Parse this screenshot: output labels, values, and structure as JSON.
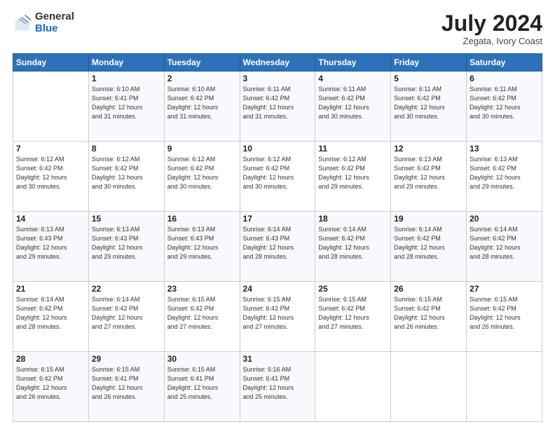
{
  "header": {
    "logo": {
      "general": "General",
      "blue": "Blue"
    },
    "month": "July 2024",
    "location": "Zegata, Ivory Coast"
  },
  "weekdays": [
    "Sunday",
    "Monday",
    "Tuesday",
    "Wednesday",
    "Thursday",
    "Friday",
    "Saturday"
  ],
  "weeks": [
    [
      {
        "day": "",
        "sunrise": "",
        "sunset": "",
        "daylight": ""
      },
      {
        "day": "1",
        "sunrise": "Sunrise: 6:10 AM",
        "sunset": "Sunset: 6:41 PM",
        "daylight": "Daylight: 12 hours and 31 minutes."
      },
      {
        "day": "2",
        "sunrise": "Sunrise: 6:10 AM",
        "sunset": "Sunset: 6:42 PM",
        "daylight": "Daylight: 12 hours and 31 minutes."
      },
      {
        "day": "3",
        "sunrise": "Sunrise: 6:11 AM",
        "sunset": "Sunset: 6:42 PM",
        "daylight": "Daylight: 12 hours and 31 minutes."
      },
      {
        "day": "4",
        "sunrise": "Sunrise: 6:11 AM",
        "sunset": "Sunset: 6:42 PM",
        "daylight": "Daylight: 12 hours and 30 minutes."
      },
      {
        "day": "5",
        "sunrise": "Sunrise: 6:11 AM",
        "sunset": "Sunset: 6:42 PM",
        "daylight": "Daylight: 12 hours and 30 minutes."
      },
      {
        "day": "6",
        "sunrise": "Sunrise: 6:11 AM",
        "sunset": "Sunset: 6:42 PM",
        "daylight": "Daylight: 12 hours and 30 minutes."
      }
    ],
    [
      {
        "day": "7",
        "sunrise": "Sunrise: 6:12 AM",
        "sunset": "Sunset: 6:42 PM",
        "daylight": "Daylight: 12 hours and 30 minutes."
      },
      {
        "day": "8",
        "sunrise": "Sunrise: 6:12 AM",
        "sunset": "Sunset: 6:42 PM",
        "daylight": "Daylight: 12 hours and 30 minutes."
      },
      {
        "day": "9",
        "sunrise": "Sunrise: 6:12 AM",
        "sunset": "Sunset: 6:42 PM",
        "daylight": "Daylight: 12 hours and 30 minutes."
      },
      {
        "day": "10",
        "sunrise": "Sunrise: 6:12 AM",
        "sunset": "Sunset: 6:42 PM",
        "daylight": "Daylight: 12 hours and 30 minutes."
      },
      {
        "day": "11",
        "sunrise": "Sunrise: 6:12 AM",
        "sunset": "Sunset: 6:42 PM",
        "daylight": "Daylight: 12 hours and 29 minutes."
      },
      {
        "day": "12",
        "sunrise": "Sunrise: 6:13 AM",
        "sunset": "Sunset: 6:42 PM",
        "daylight": "Daylight: 12 hours and 29 minutes."
      },
      {
        "day": "13",
        "sunrise": "Sunrise: 6:13 AM",
        "sunset": "Sunset: 6:42 PM",
        "daylight": "Daylight: 12 hours and 29 minutes."
      }
    ],
    [
      {
        "day": "14",
        "sunrise": "Sunrise: 6:13 AM",
        "sunset": "Sunset: 6:43 PM",
        "daylight": "Daylight: 12 hours and 29 minutes."
      },
      {
        "day": "15",
        "sunrise": "Sunrise: 6:13 AM",
        "sunset": "Sunset: 6:43 PM",
        "daylight": "Daylight: 12 hours and 29 minutes."
      },
      {
        "day": "16",
        "sunrise": "Sunrise: 6:13 AM",
        "sunset": "Sunset: 6:43 PM",
        "daylight": "Daylight: 12 hours and 29 minutes."
      },
      {
        "day": "17",
        "sunrise": "Sunrise: 6:14 AM",
        "sunset": "Sunset: 6:43 PM",
        "daylight": "Daylight: 12 hours and 28 minutes."
      },
      {
        "day": "18",
        "sunrise": "Sunrise: 6:14 AM",
        "sunset": "Sunset: 6:42 PM",
        "daylight": "Daylight: 12 hours and 28 minutes."
      },
      {
        "day": "19",
        "sunrise": "Sunrise: 6:14 AM",
        "sunset": "Sunset: 6:42 PM",
        "daylight": "Daylight: 12 hours and 28 minutes."
      },
      {
        "day": "20",
        "sunrise": "Sunrise: 6:14 AM",
        "sunset": "Sunset: 6:42 PM",
        "daylight": "Daylight: 12 hours and 28 minutes."
      }
    ],
    [
      {
        "day": "21",
        "sunrise": "Sunrise: 6:14 AM",
        "sunset": "Sunset: 6:42 PM",
        "daylight": "Daylight: 12 hours and 28 minutes."
      },
      {
        "day": "22",
        "sunrise": "Sunrise: 6:14 AM",
        "sunset": "Sunset: 6:42 PM",
        "daylight": "Daylight: 12 hours and 27 minutes."
      },
      {
        "day": "23",
        "sunrise": "Sunrise: 6:15 AM",
        "sunset": "Sunset: 6:42 PM",
        "daylight": "Daylight: 12 hours and 27 minutes."
      },
      {
        "day": "24",
        "sunrise": "Sunrise: 6:15 AM",
        "sunset": "Sunset: 6:42 PM",
        "daylight": "Daylight: 12 hours and 27 minutes."
      },
      {
        "day": "25",
        "sunrise": "Sunrise: 6:15 AM",
        "sunset": "Sunset: 6:42 PM",
        "daylight": "Daylight: 12 hours and 27 minutes."
      },
      {
        "day": "26",
        "sunrise": "Sunrise: 6:15 AM",
        "sunset": "Sunset: 6:42 PM",
        "daylight": "Daylight: 12 hours and 26 minutes."
      },
      {
        "day": "27",
        "sunrise": "Sunrise: 6:15 AM",
        "sunset": "Sunset: 6:42 PM",
        "daylight": "Daylight: 12 hours and 26 minutes."
      }
    ],
    [
      {
        "day": "28",
        "sunrise": "Sunrise: 6:15 AM",
        "sunset": "Sunset: 6:42 PM",
        "daylight": "Daylight: 12 hours and 26 minutes."
      },
      {
        "day": "29",
        "sunrise": "Sunrise: 6:15 AM",
        "sunset": "Sunset: 6:41 PM",
        "daylight": "Daylight: 12 hours and 26 minutes."
      },
      {
        "day": "30",
        "sunrise": "Sunrise: 6:15 AM",
        "sunset": "Sunset: 6:41 PM",
        "daylight": "Daylight: 12 hours and 25 minutes."
      },
      {
        "day": "31",
        "sunrise": "Sunrise: 6:16 AM",
        "sunset": "Sunset: 6:41 PM",
        "daylight": "Daylight: 12 hours and 25 minutes."
      },
      {
        "day": "",
        "sunrise": "",
        "sunset": "",
        "daylight": ""
      },
      {
        "day": "",
        "sunrise": "",
        "sunset": "",
        "daylight": ""
      },
      {
        "day": "",
        "sunrise": "",
        "sunset": "",
        "daylight": ""
      }
    ]
  ]
}
